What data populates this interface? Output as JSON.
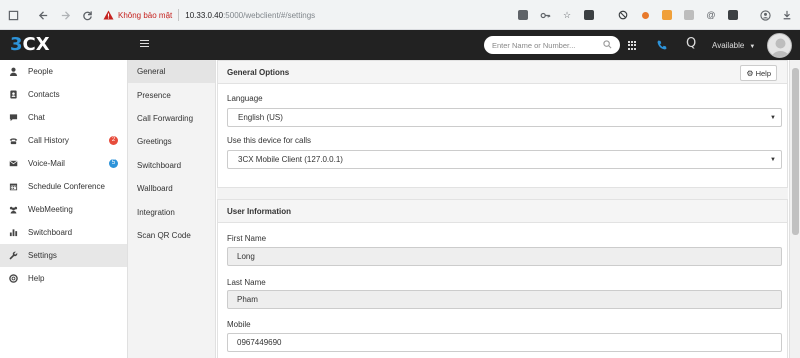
{
  "browser": {
    "security_warning": "Không bảo mật",
    "url_host": "10.33.0.40",
    "url_path": ":5000/webclient/#/settings"
  },
  "header": {
    "logo_prefix": "3",
    "logo_suffix": "CX",
    "search_placeholder": "Enter Name or Number...",
    "status": "Available",
    "presence_q": "Q"
  },
  "sidebar": {
    "items": [
      {
        "label": "People",
        "icon": "user-icon"
      },
      {
        "label": "Contacts",
        "icon": "contacts-icon"
      },
      {
        "label": "Chat",
        "icon": "chat-icon"
      },
      {
        "label": "Call History",
        "icon": "phone-icon",
        "badge": "2"
      },
      {
        "label": "Voice-Mail",
        "icon": "voicemail-icon",
        "badge": "5"
      },
      {
        "label": "Schedule Conference",
        "icon": "calendar-icon"
      },
      {
        "label": "WebMeeting",
        "icon": "meeting-icon"
      },
      {
        "label": "Switchboard",
        "icon": "chart-icon"
      },
      {
        "label": "Settings",
        "icon": "wrench-icon"
      },
      {
        "label": "Help",
        "icon": "help-icon"
      }
    ]
  },
  "settings_nav": {
    "items": [
      "General",
      "Presence",
      "Call Forwarding",
      "Greetings",
      "Switchboard",
      "Wallboard",
      "Integration",
      "Scan QR Code"
    ]
  },
  "general": {
    "title": "General Options",
    "help_label": "Help",
    "language_label": "Language",
    "language_value": "English (US)",
    "device_label": "Use this device for calls",
    "device_value": "3CX Mobile Client (127.0.0.1)"
  },
  "user_info": {
    "title": "User Information",
    "first_name_label": "First Name",
    "first_name": "Long",
    "last_name_label": "Last Name",
    "last_name": "Pham",
    "mobile_label": "Mobile",
    "mobile": "0967449690"
  },
  "colors": {
    "brand_blue": "#2d93d9",
    "header_bg": "#222222",
    "badge_red": "#e74c3c",
    "warning_red": "#c5221f"
  }
}
